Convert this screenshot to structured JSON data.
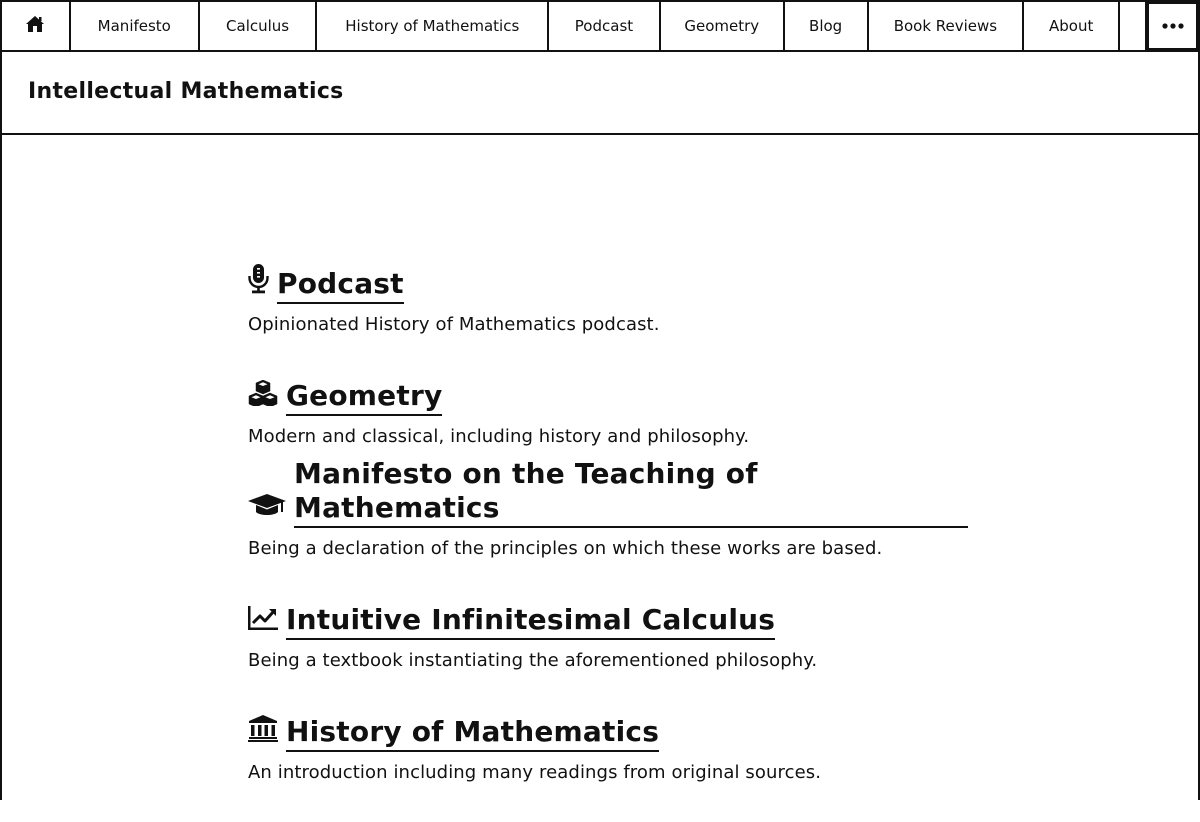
{
  "nav": {
    "home_icon": "home-icon",
    "items": [
      {
        "label": "Manifesto"
      },
      {
        "label": "Calculus"
      },
      {
        "label": "History of Mathematics"
      },
      {
        "label": "Podcast"
      },
      {
        "label": "Geometry"
      },
      {
        "label": "Blog"
      },
      {
        "label": "Book Reviews"
      },
      {
        "label": "About"
      }
    ],
    "more_icon": "ellipsis-icon"
  },
  "header": {
    "site_title": "Intellectual Mathematics"
  },
  "entries": [
    {
      "icon": "microphone-icon",
      "title": "Podcast",
      "description": "Opinionated History of Mathematics podcast."
    },
    {
      "icon": "cubes-icon",
      "title": "Geometry",
      "description": "Modern and classical, including history and philosophy."
    },
    {
      "icon": "graduation-cap-icon",
      "title": "Manifesto on the Teaching of Mathematics",
      "description": "Being a declaration of the principles on which these works are based."
    },
    {
      "icon": "line-chart-icon",
      "title": "Intuitive Infinitesimal Calculus",
      "description": "Being a textbook instantiating the aforementioned philosophy."
    },
    {
      "icon": "institution-icon",
      "title": "History of Mathematics",
      "description": "An introduction including many readings from original sources."
    }
  ],
  "colors": {
    "text": "#111111",
    "background": "#ffffff",
    "border": "#111111"
  }
}
